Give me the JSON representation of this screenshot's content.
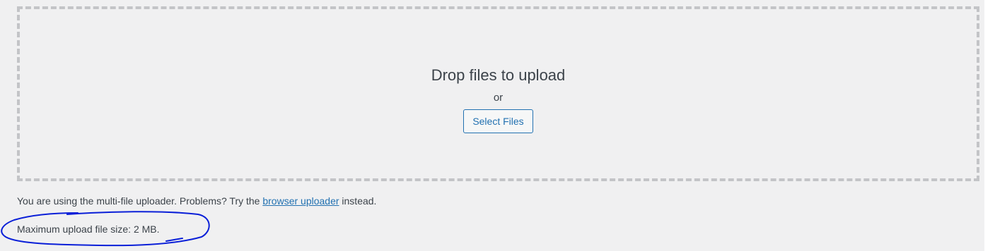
{
  "upload": {
    "title": "Drop files to upload",
    "or": "or",
    "select_button": "Select Files",
    "note_prefix": "You are using the multi-file uploader. Problems? Try the ",
    "note_link": "browser uploader",
    "note_suffix": " instead.",
    "max_size": "Maximum upload file size: 2 MB."
  },
  "colors": {
    "background": "#f0f0f1",
    "accent": "#2271b1",
    "annotation": "#0a1fd8"
  }
}
